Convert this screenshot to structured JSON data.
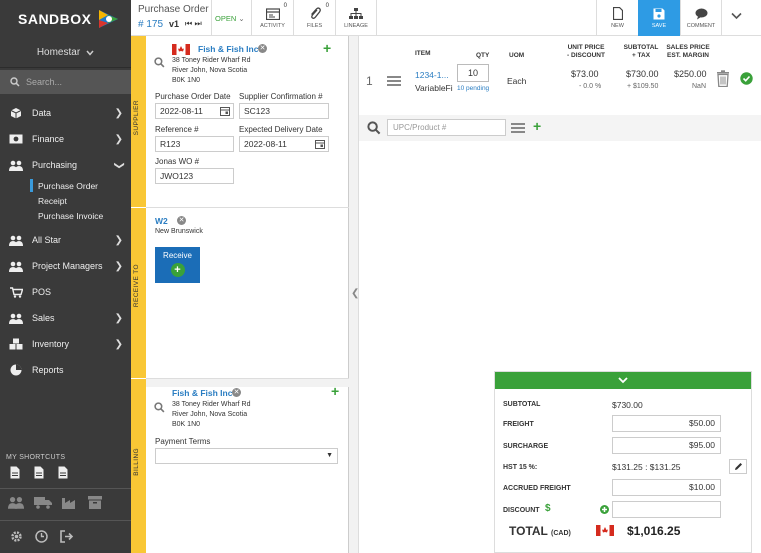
{
  "app": {
    "brand": "SANDBOX",
    "user": "Homestar",
    "search_placeholder": "Search..."
  },
  "nav": {
    "data": "Data",
    "finance": "Finance",
    "purchasing": "Purchasing",
    "sub": {
      "purchase_order": "Purchase Order",
      "receipt": "Receipt",
      "purchase_invoice": "Purchase Invoice"
    },
    "all_star": "All Star",
    "project_managers": "Project Managers",
    "pos": "POS",
    "sales": "Sales",
    "inventory": "Inventory",
    "reports": "Reports",
    "shortcuts_title": "MY SHORTCUTS"
  },
  "header": {
    "title": "Purchase Order",
    "number": "# 175",
    "version": "v1",
    "status": "OPEN",
    "activity": {
      "label": "ACTIVITY",
      "count": "0"
    },
    "files": {
      "label": "FILES",
      "count": "0"
    },
    "lineage": "LINEAGE",
    "new": "NEW",
    "save": "SAVE",
    "comment": "COMMENT"
  },
  "supplier": {
    "section_label": "SUPPLIER",
    "name": "Fish & Fish Inc",
    "address1": "38 Toney Rider Wharf Rd",
    "address2": "River John, Nova Scotia",
    "postal": "B0K 1N0",
    "po_date_label": "Purchase Order Date",
    "po_date": "2022-08-11",
    "confirm_label": "Supplier Confirmation #",
    "confirm": "SC123",
    "ref_label": "Reference #",
    "ref": "R123",
    "delivery_label": "Expected Delivery Date",
    "delivery": "2022-08-11",
    "wo_label": "Jonas WO #",
    "wo": "JWO123"
  },
  "receive_to": {
    "section_label": "RECEIVE TO",
    "name": "W2",
    "region": "New Brunswick",
    "button": "Receive"
  },
  "billing": {
    "section_label": "BILLING",
    "name": "Fish & Fish Inc",
    "address1": "38 Toney Rider Wharf Rd",
    "address2": "River John, Nova Scotia",
    "postal": "B0K 1N0",
    "terms_label": "Payment Terms",
    "terms_value": ""
  },
  "table": {
    "headers": {
      "item": "ITEM",
      "qty": "QTY",
      "uom": "UOM",
      "unit_price_1": "UNIT PRICE",
      "unit_price_2": "- DISCOUNT",
      "subtotal_1": "SUBTOTAL",
      "subtotal_2": "+ TAX",
      "sales_price_1": "SALES PRICE",
      "sales_price_2": "EST. MARGIN"
    },
    "rows": [
      {
        "line": "1",
        "item_code": "1234-1...",
        "item_name": "VariableFi",
        "qty": "10",
        "pending": "10 pending",
        "uom": "Each",
        "unit_price": "$73.00",
        "discount": "- 0.0 %",
        "subtotal": "$730.00",
        "tax": "+ $109.50",
        "sales_price": "$250.00",
        "margin": "NaN"
      }
    ],
    "upc_placeholder": "UPC/Product #"
  },
  "summary": {
    "subtotal_label": "SUBTOTAL",
    "subtotal": "$730.00",
    "freight_label": "FREIGHT",
    "freight": "$50.00",
    "surcharge_label": "SURCHARGE",
    "surcharge": "$95.00",
    "hst_label": "HST 15 %:",
    "hst": "$131.25 : $131.25",
    "accrued_label": "ACCRUED FREIGHT",
    "accrued": "$10.00",
    "discount_label": "DISCOUNT",
    "discount_symbol": "$",
    "discount": "",
    "total_label": "TOTAL",
    "total_currency": "(CAD)",
    "total": "$1,016.25"
  },
  "colors": {
    "accent": "#2e9be4",
    "green": "#3aa13a",
    "yellow": "#f9c735",
    "sidebar": "#3a3a3a",
    "link": "#2a7dc2"
  }
}
